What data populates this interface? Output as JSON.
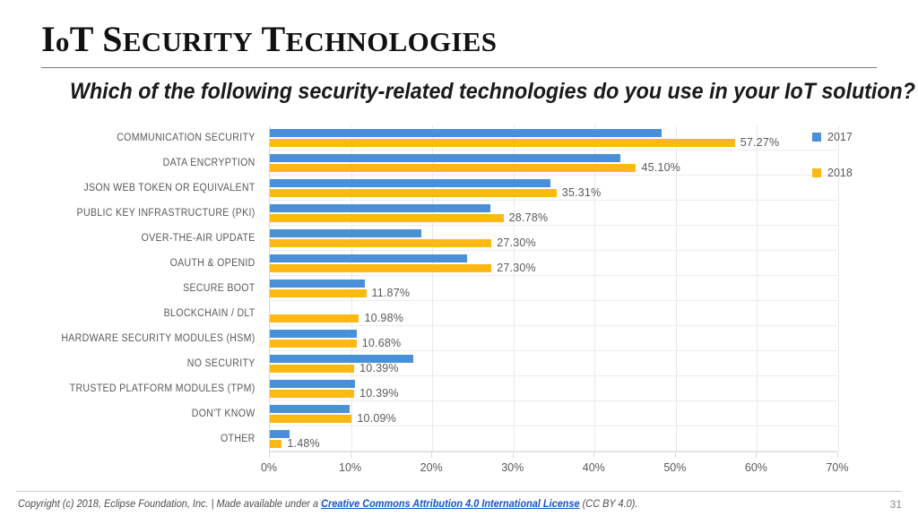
{
  "slide": {
    "title_full": "IoT Security Technologies",
    "title_parts": [
      {
        "text": "I",
        "style": "cap"
      },
      {
        "text": "o",
        "style": "sc"
      },
      {
        "text": "T",
        "style": "cap"
      },
      {
        "text": " ",
        "style": "cap"
      },
      {
        "text": "S",
        "style": "cap"
      },
      {
        "text": "ECURITY",
        "style": "sc"
      },
      {
        "text": " ",
        "style": "cap"
      },
      {
        "text": "T",
        "style": "cap"
      },
      {
        "text": "ECHNOLOGIES",
        "style": "sc"
      }
    ],
    "subtitle": "Which of the following security-related technologies do you use in your IoT solution?",
    "page_number": "31"
  },
  "footer": {
    "prefix": "Copyright (c) 2018, Eclipse Foundation, Inc. | Made available under a ",
    "link_text": "Creative Commons Attribution 4.0 International License",
    "suffix": " (CC BY 4.0)."
  },
  "colors": {
    "series_2017": "#4a90d9",
    "series_2018": "#fdb913",
    "label_text": "#595959",
    "gridline": "#e8e8e8",
    "link": "#1155cc"
  },
  "chart_data": {
    "type": "bar",
    "orientation": "horizontal",
    "title": "Which of the following security-related technologies do you use in your IoT solution?",
    "xlabel": "",
    "ylabel": "",
    "xlim": [
      0,
      70
    ],
    "xticks": [
      0,
      10,
      20,
      30,
      40,
      50,
      60,
      70
    ],
    "xticklabels": [
      "0%",
      "10%",
      "20%",
      "30%",
      "40%",
      "50%",
      "60%",
      "70%"
    ],
    "grid": true,
    "legend_position": "right",
    "value_labels_on": "2018",
    "categories": [
      "Communication Security",
      "Data Encryption",
      "JSON Web Token or Equivalent",
      "Public Key Infrastructure (PKI)",
      "Over-the-Air Update",
      "OAuth & OpenID",
      "Secure Boot",
      "Blockchain / DLT",
      "Hardware Security Modules (HSM)",
      "No Security",
      "Trusted Platform Modules (TPM)",
      "Don't Know",
      "Other"
    ],
    "series": [
      {
        "name": "2017",
        "color": "#4a90d9",
        "values": [
          48.3,
          43.2,
          34.6,
          27.2,
          18.7,
          24.3,
          11.7,
          0,
          10.7,
          17.7,
          10.5,
          9.8,
          2.4
        ],
        "labels": [
          "",
          "",
          "",
          "",
          "",
          "",
          "",
          "",
          "",
          "",
          "",
          "",
          ""
        ]
      },
      {
        "name": "2018",
        "color": "#fdb913",
        "values": [
          57.27,
          45.1,
          35.31,
          28.78,
          27.3,
          27.3,
          11.87,
          10.98,
          10.68,
          10.39,
          10.39,
          10.09,
          1.48
        ],
        "labels": [
          "57.27%",
          "45.10%",
          "35.31%",
          "28.78%",
          "27.30%",
          "27.30%",
          "11.87%",
          "10.98%",
          "10.68%",
          "10.39%",
          "10.39%",
          "10.09%",
          "1.48%"
        ]
      }
    ]
  }
}
